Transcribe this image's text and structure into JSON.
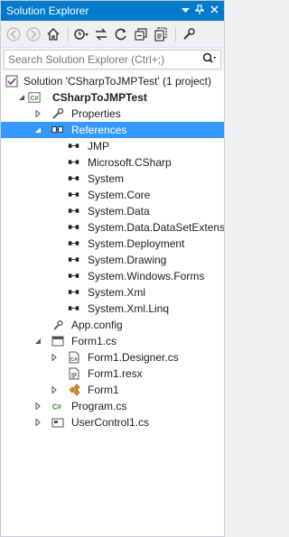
{
  "window": {
    "title": "Solution Explorer",
    "pin_glyph": "▼",
    "dock_glyph": "ᛘ",
    "close_glyph": "✕"
  },
  "toolbar": {
    "back_label": "Back",
    "forward_label": "Forward",
    "home_label": "Home"
  },
  "search": {
    "placeholder": "Search Solution Explorer (Ctrl+;)"
  },
  "tree": {
    "solution": "Solution 'CSharpToJMPTest' (1 project)",
    "project": "CSharpToJMPTest",
    "properties": "Properties",
    "references": "References",
    "ref_items": [
      "JMP",
      "Microsoft.CSharp",
      "System",
      "System.Core",
      "System.Data",
      "System.Data.DataSetExtensions",
      "System.Deployment",
      "System.Drawing",
      "System.Windows.Forms",
      "System.Xml",
      "System.Xml.Linq"
    ],
    "app_config": "App.config",
    "form1": "Form1.cs",
    "form1_designer": "Form1.Designer.cs",
    "form1_resx": "Form1.resx",
    "form1_class": "Form1",
    "program": "Program.cs",
    "usercontrol": "UserControl1.cs"
  },
  "colors": {
    "accent": "#007acc",
    "selection": "#3399ff",
    "csharp_green": "#388a34"
  }
}
